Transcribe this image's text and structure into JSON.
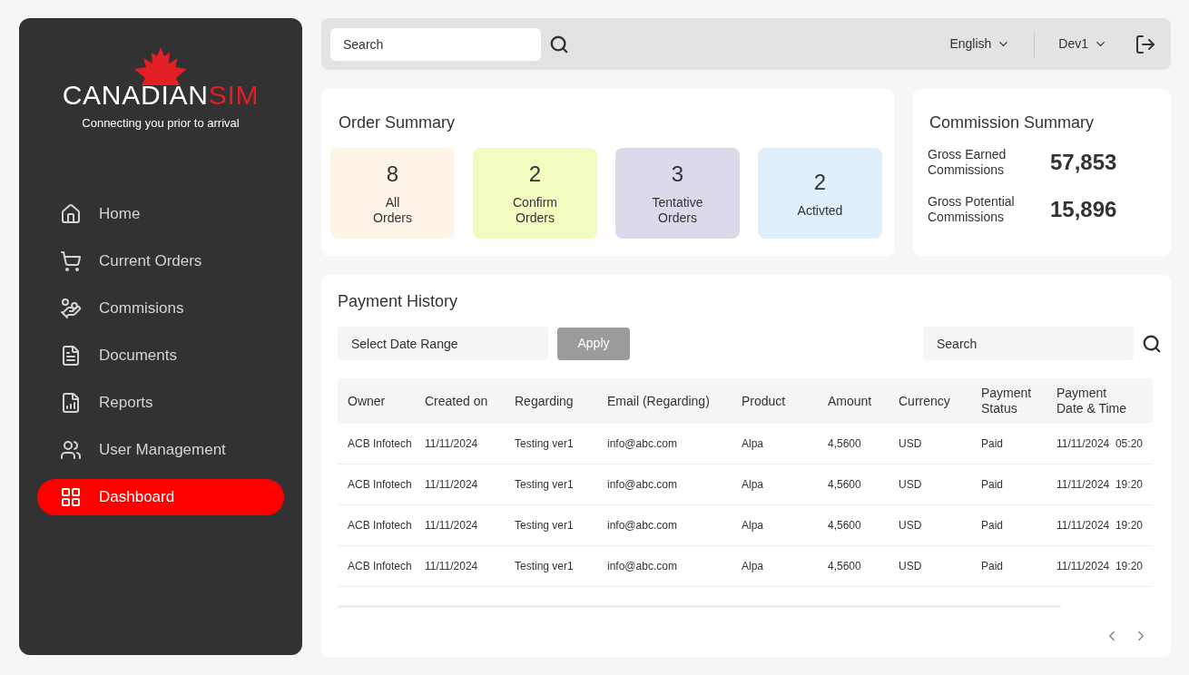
{
  "sidebar": {
    "logo": {
      "name_1": "CANADIAN",
      "name_2": "SIM",
      "tagline": "Connecting you prior to arrival"
    },
    "items": [
      {
        "label": "Home",
        "kind": "home",
        "selected": false
      },
      {
        "label": "Current Orders",
        "kind": "orders",
        "selected": false
      },
      {
        "label": "Commisions",
        "kind": "commissions",
        "selected": false
      },
      {
        "label": "Documents",
        "kind": "documents",
        "selected": false
      },
      {
        "label": "Reports",
        "kind": "reports",
        "selected": false
      },
      {
        "label": "User Management",
        "kind": "users",
        "selected": false
      },
      {
        "label": "Dashboard",
        "kind": "dashboard",
        "selected": true
      }
    ]
  },
  "top_bar": {
    "search": {
      "placeholder": "Search"
    },
    "language": "English",
    "user": "Dev1"
  },
  "order_summary": {
    "title": "Order Summary",
    "tiles": [
      {
        "count": "8",
        "label": "All\nOrders",
        "color": "#fdf3e7"
      },
      {
        "count": "2",
        "label": "Confirm\nOrders",
        "color": "#f1fcc0"
      },
      {
        "count": "3",
        "label": "Tentative\nOrders",
        "color": "#dcdaea"
      },
      {
        "count": "2",
        "label": "Activted",
        "color": "#dfeffc"
      }
    ]
  },
  "commission_summary": {
    "title": "Commission Summary",
    "rows": [
      {
        "label": "Gross Earned\nCommissions",
        "value": "57,853"
      },
      {
        "label": "Gross Potential\nCommissions",
        "value": "15,896"
      }
    ]
  },
  "payment_history": {
    "title": "Payment History",
    "date_range": {
      "placeholder": "Select Date Range"
    },
    "apply_button": "Apply",
    "search": {
      "placeholder": "Search"
    },
    "table": {
      "columns": [
        "Owner",
        "Created on",
        "Regarding",
        "Email (Regarding)",
        "Product",
        "Amount",
        "Currency",
        "Payment\nStatus",
        "Payment\nDate & Time"
      ],
      "rows": [
        [
          "ACB Infotech",
          "11/11/2024",
          "Testing ver1",
          "info@abc.com",
          "Alpa",
          "4,5600",
          "USD",
          "Paid",
          "11/11/2024  05:20"
        ],
        [
          "ACB Infotech",
          "11/11/2024",
          "Testing ver1",
          "info@abc.com",
          "Alpa",
          "4,5600",
          "USD",
          "Paid",
          "11/11/2024  19:20"
        ],
        [
          "ACB Infotech",
          "11/11/2024",
          "Testing ver1",
          "info@abc.com",
          "Alpa",
          "4,5600",
          "USD",
          "Paid",
          "11/11/2024  19:20"
        ],
        [
          "ACB Infotech",
          "11/11/2024",
          "Testing ver1",
          "info@abc.com",
          "Alpa",
          "4,5600",
          "USD",
          "Paid",
          "11/11/2024  19:20"
        ]
      ]
    }
  }
}
